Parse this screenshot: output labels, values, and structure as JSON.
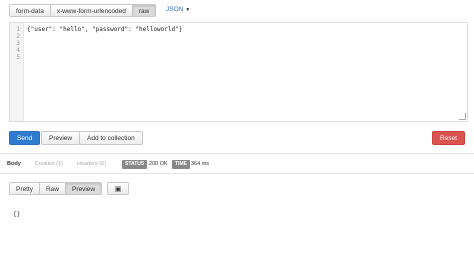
{
  "body_modes": [
    "form-data",
    "x-www-form-urlencoded",
    "raw"
  ],
  "format_label": "JSON",
  "editor": {
    "line_numbers": [
      "1",
      "2",
      "3",
      "4",
      "5"
    ],
    "code": "{\"user\": \"hello\", \"password\": \"helloworld\"}"
  },
  "actions": {
    "send": "Send",
    "preview": "Preview",
    "add_to_collection": "Add to collection",
    "reset": "Reset"
  },
  "response_tabs": [
    "Body",
    "Cookies (1)",
    "Headers (6)"
  ],
  "status": {
    "label": "STATUS",
    "value": "200 OK"
  },
  "time": {
    "label": "TIME",
    "value": "364 ms"
  },
  "view_modes": [
    "Pretty",
    "Raw",
    "Preview"
  ],
  "response_body": "{}",
  "icons": {
    "format_caret": "caret-down-icon",
    "wrap": "wrap-lines-icon"
  },
  "colors": {
    "primary": "#2f7bd0",
    "danger": "#d9534f",
    "link": "#2a6bd1"
  }
}
